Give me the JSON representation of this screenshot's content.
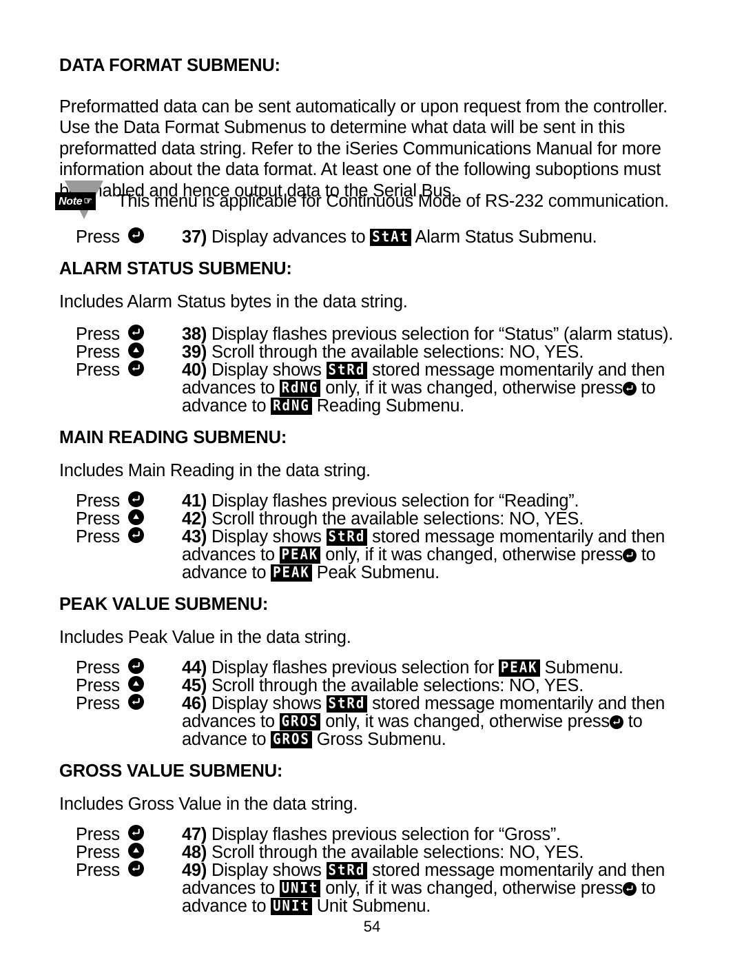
{
  "document": {
    "page_number": "54"
  },
  "sections": {
    "data_format": {
      "heading": "DATA FORMAT SUBMENU:",
      "paragraph_lines": [
        "Preformatted data can be sent automatically or upon request from the controller.",
        "Use the Data Format Submenus to determine what data will be sent in this",
        "preformatted data string. Refer to the iSeries Communications Manual for more",
        "information about the data format. At least one of the following suboptions must",
        "be enabled and hence output data to the Serial Bus."
      ],
      "note": {
        "badge_label": "Note",
        "hand_icon": "☞",
        "text": "This menu is applicable for Continuous Mode of RS-232 communication."
      },
      "step": {
        "press_label": "Press",
        "press_icon": "enter-arrow-icon",
        "number": "37)",
        "text_before": "Display advances to",
        "lcd": "StAt",
        "text_after": "Alarm Status Submenu."
      }
    },
    "alarm_status": {
      "heading": "ALARM STATUS SUBMENU:",
      "description": "Includes Alarm Status bytes in the data string.",
      "rows": [
        {
          "press_label": "Press",
          "press_icon": "enter-arrow-icon",
          "number": "38)",
          "text": "Display flashes previous selection for “Status” (alarm status)."
        },
        {
          "press_label": "Press",
          "press_icon": "up-triangle-icon",
          "number": "39)",
          "text": "Scroll through the available selections: NO, YES."
        },
        {
          "press_label": "Press",
          "press_icon": "enter-arrow-icon",
          "number": "40)",
          "line1_before": "Display shows",
          "line1_lcd": "StRd",
          "line1_after": "stored message momentarily and then",
          "line2_before": "advances to",
          "line2_lcd": "RdNG",
          "line2_mid": "only, if it was changed, otherwise press",
          "line2_icon": "enter-arrow-icon",
          "line2_after": "to",
          "line3_before": "advance to",
          "line3_lcd": "RdNG",
          "line3_after": "Reading Submenu."
        }
      ]
    },
    "main_reading": {
      "heading": "MAIN READING SUBMENU:",
      "description": "Includes Main Reading in the data string.",
      "rows": [
        {
          "press_label": "Press",
          "press_icon": "enter-arrow-icon",
          "number": "41)",
          "text": "Display flashes previous selection for “Reading”."
        },
        {
          "press_label": "Press",
          "press_icon": "up-triangle-icon",
          "number": "42)",
          "text": "Scroll through the available selections: NO, YES."
        },
        {
          "press_label": "Press",
          "press_icon": "enter-arrow-icon",
          "number": "43)",
          "line1_before": "Display shows",
          "line1_lcd": "StRd",
          "line1_after": "stored message momentarily and then",
          "line2_before": "advances to",
          "line2_lcd": "PEAK",
          "line2_mid": "only, if it was changed, otherwise press",
          "line2_icon": "enter-arrow-icon",
          "line2_after": "to",
          "line3_before": "advance to",
          "line3_lcd": "PEAK",
          "line3_after": "Peak Submenu."
        }
      ]
    },
    "peak_value": {
      "heading": "PEAK VALUE SUBMENU:",
      "description": "Includes Peak Value in the data string.",
      "rows": [
        {
          "press_label": "Press",
          "press_icon": "enter-arrow-icon",
          "number": "44)",
          "text_before": "Display flashes previous selection for",
          "lcd": "PEAK",
          "text_after": "Submenu."
        },
        {
          "press_label": "Press",
          "press_icon": "up-triangle-icon",
          "number": "45)",
          "text": "Scroll through the available selections: NO, YES."
        },
        {
          "press_label": "Press",
          "press_icon": "enter-arrow-icon",
          "number": "46)",
          "line1_before": "Display shows",
          "line1_lcd": "StRd",
          "line1_after": "stored message momentarily and then",
          "line2_before": "advances to",
          "line2_lcd": "GROS",
          "line2_mid": "only, it  was changed, otherwise press",
          "line2_icon": "enter-arrow-icon",
          "line2_after": "to",
          "line3_before": "advance to",
          "line3_lcd": "GROS",
          "line3_after": "Gross Submenu."
        }
      ]
    },
    "gross_value": {
      "heading": "GROSS VALUE SUBMENU:",
      "description": "Includes Gross Value in the data string.",
      "rows": [
        {
          "press_label": "Press",
          "press_icon": "enter-arrow-icon",
          "number": "47)",
          "text": "Display flashes previous selection for “Gross”."
        },
        {
          "press_label": "Press",
          "press_icon": "up-triangle-icon",
          "number": "48)",
          "text": "Scroll through the available selections: NO, YES."
        },
        {
          "press_label": "Press",
          "press_icon": "enter-arrow-icon",
          "number": "49)",
          "line1_before": "Display shows",
          "line1_lcd": "StRd",
          "line1_after": "stored message momentarily and then",
          "line2_before": "advances to",
          "line2_lcd": "UNIt",
          "line2_mid": "only, if it was changed, otherwise press",
          "line2_icon": "enter-arrow-icon",
          "line2_after": "to",
          "line3_before": "advance to",
          "line3_lcd": "UNIt",
          "line3_after": "Unit Submenu."
        }
      ]
    }
  }
}
